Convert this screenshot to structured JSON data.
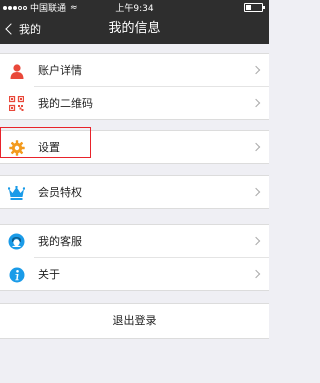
{
  "status_bar": {
    "carrier": "中国联通",
    "time": "上午9:34",
    "battery_level": 0.35
  },
  "nav": {
    "back_label": "我的",
    "title": "我的信息"
  },
  "groups": [
    {
      "items": [
        {
          "label": "账户详情",
          "icon": "user-icon"
        },
        {
          "label": "我的二维码",
          "icon": "qr-code-icon"
        }
      ]
    },
    {
      "items": [
        {
          "label": "设置",
          "icon": "gear-icon"
        }
      ]
    },
    {
      "items": [
        {
          "label": "会员特权",
          "icon": "crown-icon"
        }
      ]
    },
    {
      "items": [
        {
          "label": "我的客服",
          "icon": "customer-service-icon"
        },
        {
          "label": "关于",
          "icon": "info-icon"
        }
      ]
    }
  ],
  "logout_label": "退出登录",
  "colors": {
    "nav_bg": "#2e2e2e",
    "accent_orange": "#f39a1e",
    "user_red": "#e9483a",
    "info_blue": "#1a9be8",
    "highlight_red": "#e8232b"
  }
}
